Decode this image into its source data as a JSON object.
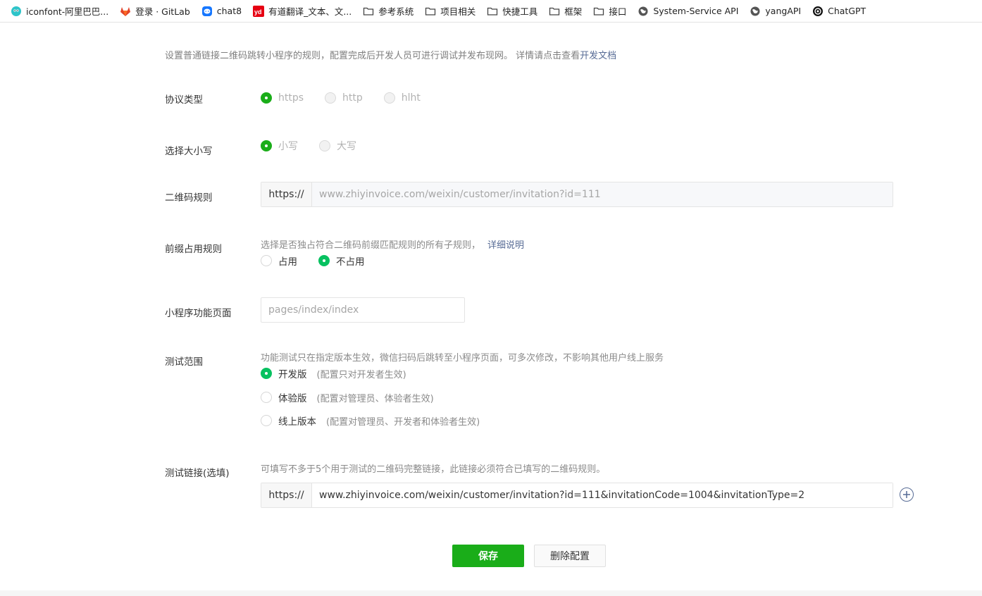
{
  "bookmarks": [
    {
      "label": "iconfont-阿里巴巴...",
      "icon": "iconfont-icon"
    },
    {
      "label": "登录 · GitLab",
      "icon": "gitlab-icon"
    },
    {
      "label": "chat8",
      "icon": "chat-icon"
    },
    {
      "label": "有道翻译_文本、文...",
      "icon": "youdao-icon"
    },
    {
      "label": "参考系统",
      "icon": "folder-icon"
    },
    {
      "label": "项目相关",
      "icon": "folder-icon"
    },
    {
      "label": "快捷工具",
      "icon": "folder-icon"
    },
    {
      "label": "框架",
      "icon": "folder-icon"
    },
    {
      "label": "接口",
      "icon": "folder-icon"
    },
    {
      "label": "System-Service API",
      "icon": "globe-icon"
    },
    {
      "label": "yangAPI",
      "icon": "globe-icon"
    },
    {
      "label": "ChatGPT",
      "icon": "openai-icon"
    }
  ],
  "intro": {
    "text": "设置普通链接二维码跳转小程序的规则，配置完成后开发人员可进行调试并发布现网。 详情请点击查看",
    "link": "开发文档"
  },
  "protocol": {
    "label": "协议类型",
    "options": [
      "https",
      "http",
      "hlht"
    ],
    "selected": "https"
  },
  "case": {
    "label": "选择大小写",
    "options": [
      "小写",
      "大写"
    ],
    "selected": "小写"
  },
  "qr_rule": {
    "label": "二维码规则",
    "prefix": "https://",
    "value": "www.zhiyinvoice.com/weixin/customer/invitation?id=111"
  },
  "prefix_rule": {
    "label": "前缀占用规则",
    "hint": "选择是否独占符合二维码前缀匹配规则的所有子规则，",
    "hint_link": "详细说明",
    "options": [
      "占用",
      "不占用"
    ],
    "selected": "不占用"
  },
  "page": {
    "label": "小程序功能页面",
    "placeholder": "pages/index/index"
  },
  "test_scope": {
    "label": "测试范围",
    "hint": "功能测试只在指定版本生效，微信扫码后跳转至小程序页面，可多次修改，不影响其他用户线上服务",
    "options": [
      {
        "name": "开发版",
        "note": "(配置只对开发者生效)"
      },
      {
        "name": "体验版",
        "note": "(配置对管理员、体验者生效)"
      },
      {
        "name": "线上版本",
        "note": "(配置对管理员、开发者和体验者生效)"
      }
    ],
    "selected": "开发版"
  },
  "test_link": {
    "label": "测试链接(选填)",
    "hint": "可填写不多于5个用于测试的二维码完整链接，此链接必须符合已填写的二维码规则。",
    "prefix": "https://",
    "value": "www.zhiyinvoice.com/weixin/customer/invitation?id=111&invitationCode=1004&invitationType=2"
  },
  "actions": {
    "save": "保存",
    "delete": "删除配置"
  },
  "colors": {
    "primary": "#1aad19",
    "radio_on": "#07c160",
    "link": "#576b95"
  }
}
